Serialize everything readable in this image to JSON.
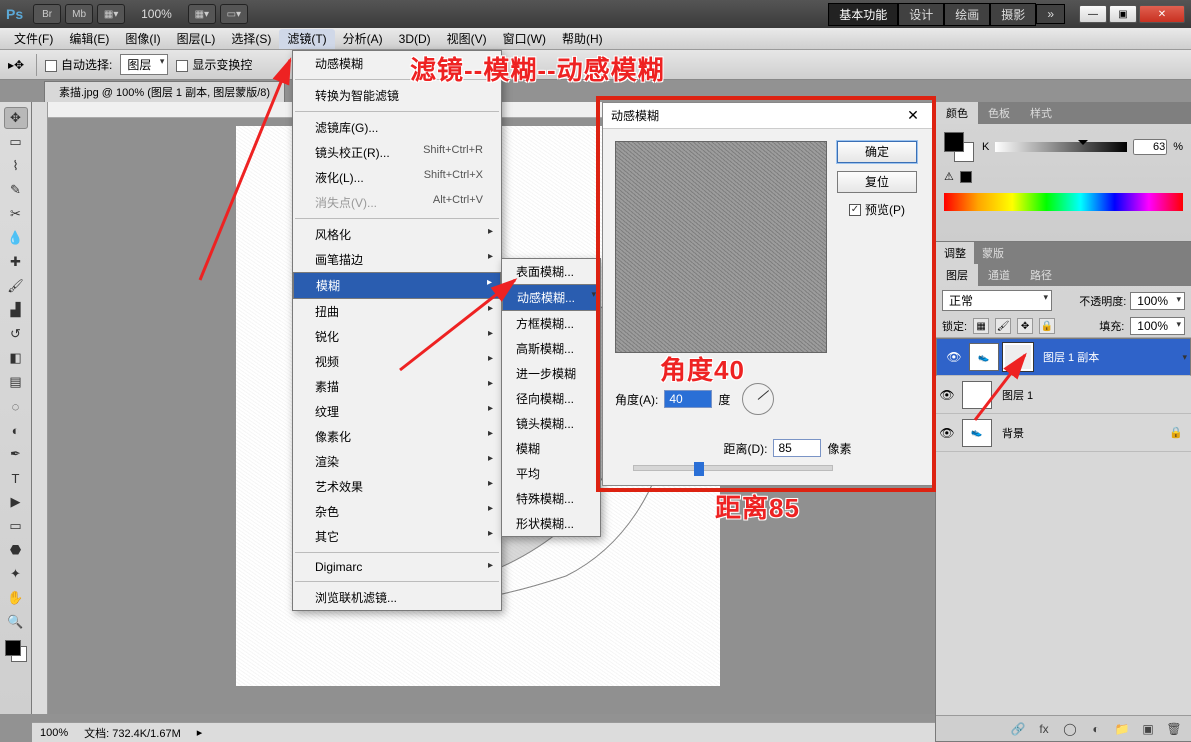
{
  "titlebar": {
    "logo": "Ps",
    "btn_br": "Br",
    "btn_mb": "Mb",
    "zoom": "100%",
    "workspace_active": "基本功能",
    "workspaces": [
      "设计",
      "绘画",
      "摄影"
    ],
    "min": "—",
    "max": "▣",
    "close": "✕"
  },
  "menubar": {
    "items": [
      "文件(F)",
      "编辑(E)",
      "图像(I)",
      "图层(L)",
      "选择(S)",
      "滤镜(T)",
      "分析(A)",
      "3D(D)",
      "视图(V)",
      "窗口(W)",
      "帮助(H)"
    ],
    "open_index": 5
  },
  "optbar": {
    "auto_select": "自动选择:",
    "layer_sel": "图层",
    "show_transform": "显示变换控"
  },
  "tabbar": {
    "tab": "素描.jpg @ 100% (图层 1 副本, 图层蒙版/8)"
  },
  "filtermenu": {
    "top": "动感模糊",
    "convert": "转换为智能滤镜",
    "lib": "滤镜库(G)...",
    "lens": "镜头校正(R)...",
    "lens_sc": "Shift+Ctrl+R",
    "liquify": "液化(L)...",
    "liquify_sc": "Shift+Ctrl+X",
    "vanish": "消失点(V)...",
    "vanish_sc": "Alt+Ctrl+V",
    "groups": [
      "风格化",
      "画笔描边",
      "模糊",
      "扭曲",
      "锐化",
      "视频",
      "素描",
      "纹理",
      "像素化",
      "渲染",
      "艺术效果",
      "杂色",
      "其它"
    ],
    "digimarc": "Digimarc",
    "browse": "浏览联机滤镜..."
  },
  "blurmenu": {
    "items": [
      "表面模糊...",
      "动感模糊...",
      "方框模糊...",
      "高斯模糊...",
      "进一步模糊",
      "径向模糊...",
      "镜头模糊...",
      "模糊",
      "平均",
      "特殊模糊...",
      "形状模糊..."
    ],
    "sel_index": 1
  },
  "dialog": {
    "title": "动感模糊",
    "ok": "确定",
    "cancel": "复位",
    "preview": "预览(P)",
    "angle_label": "角度(A):",
    "angle_value": "40",
    "angle_unit": "度",
    "dist_label": "距离(D):",
    "dist_value": "85",
    "dist_unit": "像素"
  },
  "annotations": {
    "path": "滤镜--模糊--动感模糊",
    "angle": "角度40",
    "dist": "距离85"
  },
  "colorpanel": {
    "tabs": [
      "颜色",
      "色板",
      "样式"
    ],
    "channel": "K",
    "value": "63",
    "pct": "%"
  },
  "adjustpanel": {
    "tabs": [
      "调整",
      "蒙版"
    ]
  },
  "layerspanel": {
    "tabs": [
      "图层",
      "通道",
      "路径"
    ],
    "blend_mode": "正常",
    "opacity_label": "不透明度:",
    "opacity": "100%",
    "lock_label": "锁定:",
    "fill_label": "填充:",
    "fill": "100%",
    "layers": [
      {
        "name": "图层 1 副本",
        "selected": true,
        "has_mask": true
      },
      {
        "name": "图层 1",
        "selected": false,
        "has_mask": false
      },
      {
        "name": "背景",
        "selected": false,
        "has_mask": false,
        "locked": true
      }
    ]
  },
  "statusbar": {
    "zoom": "100%",
    "docinfo": "文档: 732.4K/1.67M"
  }
}
